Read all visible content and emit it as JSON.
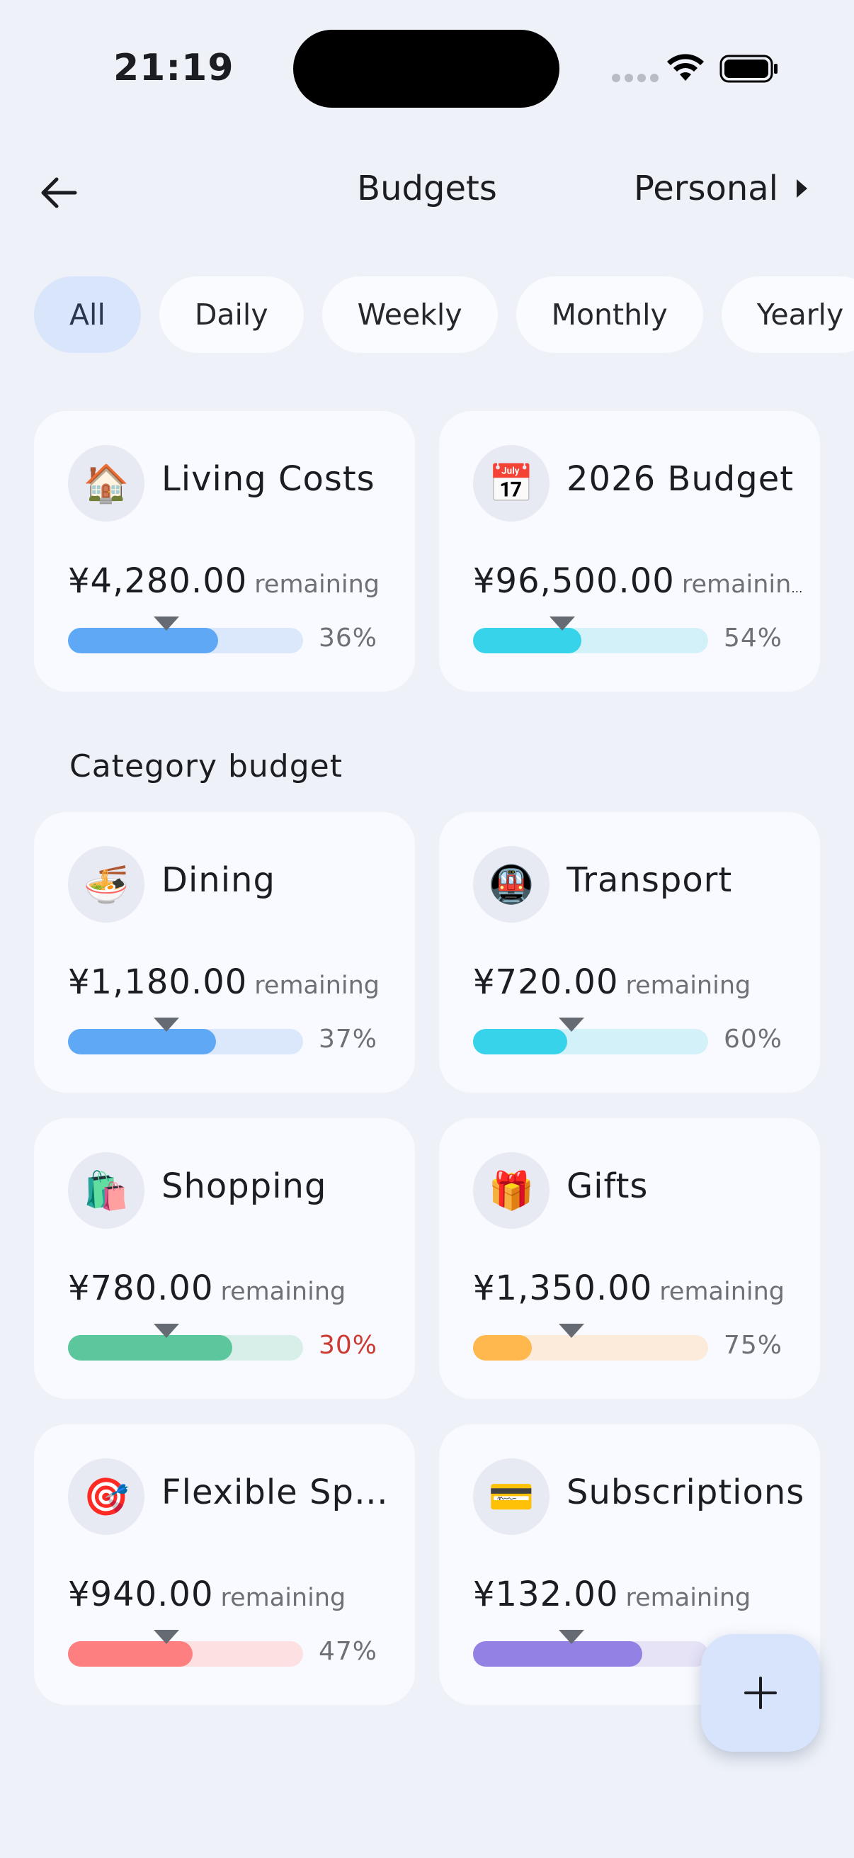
{
  "status": {
    "time": "21:19"
  },
  "header": {
    "title": "Budgets",
    "ledger": "Personal"
  },
  "tabs": [
    {
      "label": "All",
      "active": true
    },
    {
      "label": "Daily",
      "active": false
    },
    {
      "label": "Weekly",
      "active": false
    },
    {
      "label": "Monthly",
      "active": false
    },
    {
      "label": "Yearly",
      "active": false
    }
  ],
  "top_budgets": [
    {
      "icon": "🏠",
      "icon_name": "house-icon",
      "name": "Living Costs",
      "amount": "¥4,280.00",
      "remaining_label": "remaining",
      "percent": "36%",
      "progress": 0.64,
      "marker": 0.42,
      "color": "#5ea8f6",
      "track_color": "#dbe8fb",
      "warn": false
    },
    {
      "icon": "📅",
      "icon_name": "calendar-icon",
      "name": "2026 Budget",
      "amount": "¥96,500.00",
      "remaining_label": "remaining",
      "percent": "54%",
      "progress": 0.46,
      "marker": 0.38,
      "color": "#36d3ea",
      "track_color": "#d3f1f8",
      "warn": false
    }
  ],
  "section_title": "Category budget",
  "category_budgets": [
    {
      "icon": "🍜",
      "icon_name": "noodle-bowl-icon",
      "name": "Dining",
      "amount": "¥1,180.00",
      "remaining_label": "remaining",
      "percent": "37%",
      "progress": 0.63,
      "marker": 0.42,
      "color": "#5ea8f6",
      "track_color": "#dbe8fb",
      "warn": false
    },
    {
      "icon": "🚇",
      "icon_name": "metro-icon",
      "name": "Transport",
      "amount": "¥720.00",
      "remaining_label": "remaining",
      "percent": "60%",
      "progress": 0.4,
      "marker": 0.42,
      "color": "#36d3ea",
      "track_color": "#d3f1f8",
      "warn": false
    },
    {
      "icon": "🛍️",
      "icon_name": "shopping-bags-icon",
      "name": "Shopping",
      "amount": "¥780.00",
      "remaining_label": "remaining",
      "percent": "30%",
      "progress": 0.7,
      "marker": 0.42,
      "color": "#5cc69d",
      "track_color": "#d8eee8",
      "warn": true
    },
    {
      "icon": "🎁",
      "icon_name": "gift-icon",
      "name": "Gifts",
      "amount": "¥1,350.00",
      "remaining_label": "remaining",
      "percent": "75%",
      "progress": 0.25,
      "marker": 0.42,
      "color": "#ffb84d",
      "track_color": "#fcebdb",
      "warn": false
    },
    {
      "icon": "🎯",
      "icon_name": "target-icon",
      "name": "Flexible Spending",
      "amount": "¥940.00",
      "remaining_label": "remaining",
      "percent": "47%",
      "progress": 0.53,
      "marker": 0.42,
      "color": "#fd7f7f",
      "track_color": "#fde0e2",
      "warn": false
    },
    {
      "icon": "💳",
      "icon_name": "credit-card-icon",
      "name": "Subscriptions",
      "amount": "¥132.00",
      "remaining_label": "remaining",
      "percent": "",
      "progress": 0.72,
      "marker": 0.42,
      "color": "#9381e3",
      "track_color": "#e6e3f7",
      "warn": false
    }
  ]
}
